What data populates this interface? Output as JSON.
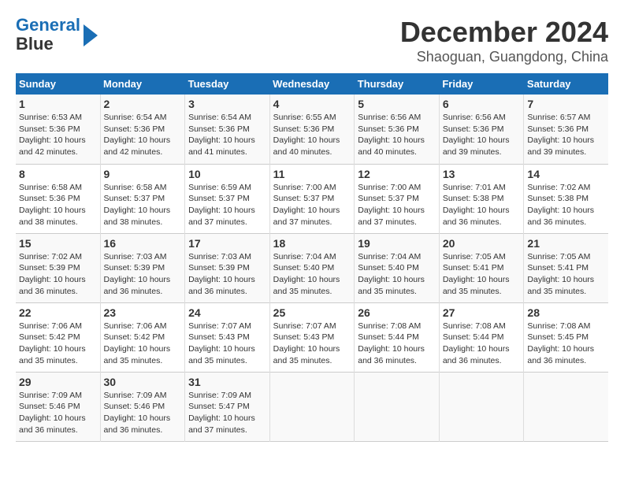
{
  "logo": {
    "line1": "General",
    "line2": "Blue"
  },
  "title": "December 2024",
  "subtitle": "Shaoguan, Guangdong, China",
  "days_of_week": [
    "Sunday",
    "Monday",
    "Tuesday",
    "Wednesday",
    "Thursday",
    "Friday",
    "Saturday"
  ],
  "weeks": [
    [
      {
        "day": "1",
        "detail": "Sunrise: 6:53 AM\nSunset: 5:36 PM\nDaylight: 10 hours\nand 42 minutes."
      },
      {
        "day": "2",
        "detail": "Sunrise: 6:54 AM\nSunset: 5:36 PM\nDaylight: 10 hours\nand 42 minutes."
      },
      {
        "day": "3",
        "detail": "Sunrise: 6:54 AM\nSunset: 5:36 PM\nDaylight: 10 hours\nand 41 minutes."
      },
      {
        "day": "4",
        "detail": "Sunrise: 6:55 AM\nSunset: 5:36 PM\nDaylight: 10 hours\nand 40 minutes."
      },
      {
        "day": "5",
        "detail": "Sunrise: 6:56 AM\nSunset: 5:36 PM\nDaylight: 10 hours\nand 40 minutes."
      },
      {
        "day": "6",
        "detail": "Sunrise: 6:56 AM\nSunset: 5:36 PM\nDaylight: 10 hours\nand 39 minutes."
      },
      {
        "day": "7",
        "detail": "Sunrise: 6:57 AM\nSunset: 5:36 PM\nDaylight: 10 hours\nand 39 minutes."
      }
    ],
    [
      {
        "day": "8",
        "detail": "Sunrise: 6:58 AM\nSunset: 5:36 PM\nDaylight: 10 hours\nand 38 minutes."
      },
      {
        "day": "9",
        "detail": "Sunrise: 6:58 AM\nSunset: 5:37 PM\nDaylight: 10 hours\nand 38 minutes."
      },
      {
        "day": "10",
        "detail": "Sunrise: 6:59 AM\nSunset: 5:37 PM\nDaylight: 10 hours\nand 37 minutes."
      },
      {
        "day": "11",
        "detail": "Sunrise: 7:00 AM\nSunset: 5:37 PM\nDaylight: 10 hours\nand 37 minutes."
      },
      {
        "day": "12",
        "detail": "Sunrise: 7:00 AM\nSunset: 5:37 PM\nDaylight: 10 hours\nand 37 minutes."
      },
      {
        "day": "13",
        "detail": "Sunrise: 7:01 AM\nSunset: 5:38 PM\nDaylight: 10 hours\nand 36 minutes."
      },
      {
        "day": "14",
        "detail": "Sunrise: 7:02 AM\nSunset: 5:38 PM\nDaylight: 10 hours\nand 36 minutes."
      }
    ],
    [
      {
        "day": "15",
        "detail": "Sunrise: 7:02 AM\nSunset: 5:39 PM\nDaylight: 10 hours\nand 36 minutes."
      },
      {
        "day": "16",
        "detail": "Sunrise: 7:03 AM\nSunset: 5:39 PM\nDaylight: 10 hours\nand 36 minutes."
      },
      {
        "day": "17",
        "detail": "Sunrise: 7:03 AM\nSunset: 5:39 PM\nDaylight: 10 hours\nand 36 minutes."
      },
      {
        "day": "18",
        "detail": "Sunrise: 7:04 AM\nSunset: 5:40 PM\nDaylight: 10 hours\nand 35 minutes."
      },
      {
        "day": "19",
        "detail": "Sunrise: 7:04 AM\nSunset: 5:40 PM\nDaylight: 10 hours\nand 35 minutes."
      },
      {
        "day": "20",
        "detail": "Sunrise: 7:05 AM\nSunset: 5:41 PM\nDaylight: 10 hours\nand 35 minutes."
      },
      {
        "day": "21",
        "detail": "Sunrise: 7:05 AM\nSunset: 5:41 PM\nDaylight: 10 hours\nand 35 minutes."
      }
    ],
    [
      {
        "day": "22",
        "detail": "Sunrise: 7:06 AM\nSunset: 5:42 PM\nDaylight: 10 hours\nand 35 minutes."
      },
      {
        "day": "23",
        "detail": "Sunrise: 7:06 AM\nSunset: 5:42 PM\nDaylight: 10 hours\nand 35 minutes."
      },
      {
        "day": "24",
        "detail": "Sunrise: 7:07 AM\nSunset: 5:43 PM\nDaylight: 10 hours\nand 35 minutes."
      },
      {
        "day": "25",
        "detail": "Sunrise: 7:07 AM\nSunset: 5:43 PM\nDaylight: 10 hours\nand 35 minutes."
      },
      {
        "day": "26",
        "detail": "Sunrise: 7:08 AM\nSunset: 5:44 PM\nDaylight: 10 hours\nand 36 minutes."
      },
      {
        "day": "27",
        "detail": "Sunrise: 7:08 AM\nSunset: 5:44 PM\nDaylight: 10 hours\nand 36 minutes."
      },
      {
        "day": "28",
        "detail": "Sunrise: 7:08 AM\nSunset: 5:45 PM\nDaylight: 10 hours\nand 36 minutes."
      }
    ],
    [
      {
        "day": "29",
        "detail": "Sunrise: 7:09 AM\nSunset: 5:46 PM\nDaylight: 10 hours\nand 36 minutes."
      },
      {
        "day": "30",
        "detail": "Sunrise: 7:09 AM\nSunset: 5:46 PM\nDaylight: 10 hours\nand 36 minutes."
      },
      {
        "day": "31",
        "detail": "Sunrise: 7:09 AM\nSunset: 5:47 PM\nDaylight: 10 hours\nand 37 minutes."
      },
      {
        "day": "",
        "detail": ""
      },
      {
        "day": "",
        "detail": ""
      },
      {
        "day": "",
        "detail": ""
      },
      {
        "day": "",
        "detail": ""
      }
    ]
  ]
}
